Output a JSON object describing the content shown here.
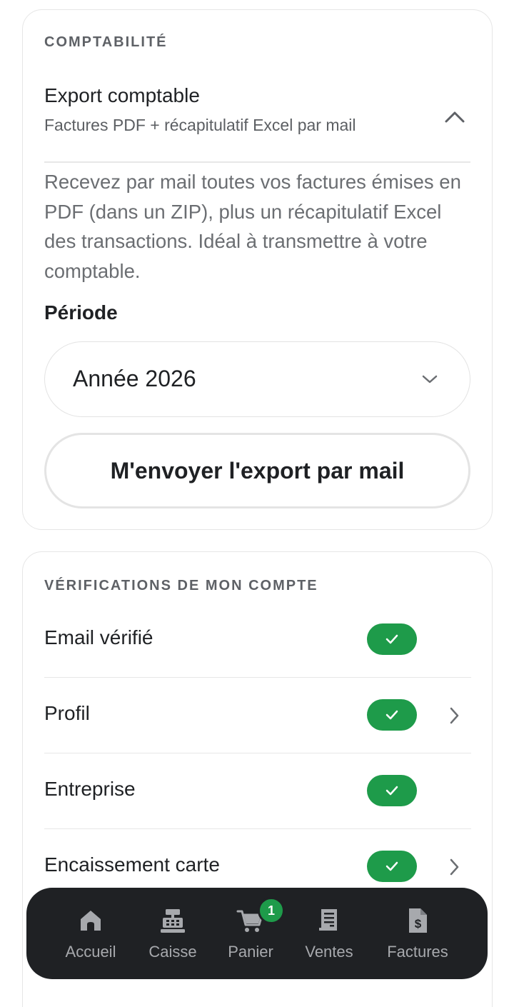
{
  "accounting": {
    "section_title": "COMPTABILITÉ",
    "export_title": "Export comptable",
    "export_subtitle": "Factures PDF + récapitulatif Excel par mail",
    "description": "Recevez par mail toutes vos factures émises en PDF (dans un ZIP), plus un récapitulatif Excel des transactions. Idéal à transmettre à votre comptable.",
    "period_label": "Période",
    "period_selected": "Année 2026",
    "send_button_label": "M'envoyer l'export par mail",
    "expanded": true
  },
  "verifications": {
    "section_title": "VÉRIFICATIONS DE MON COMPTE",
    "items": [
      {
        "label": "Email vérifié",
        "verified": true,
        "has_chevron": false
      },
      {
        "label": "Profil",
        "verified": true,
        "has_chevron": true
      },
      {
        "label": "Entreprise",
        "verified": true,
        "has_chevron": false
      },
      {
        "label": "Encaissement carte",
        "verified": true,
        "has_chevron": true
      }
    ]
  },
  "bottom_nav": {
    "items": [
      {
        "label": "Accueil",
        "icon": "home-icon"
      },
      {
        "label": "Caisse",
        "icon": "cash-register-icon"
      },
      {
        "label": "Panier",
        "icon": "cart-icon",
        "badge": "1"
      },
      {
        "label": "Ventes",
        "icon": "receipt-icon"
      },
      {
        "label": "Factures",
        "icon": "invoice-dollar-icon"
      }
    ]
  },
  "colors": {
    "success_green": "#1e9b4a",
    "nav_background": "#1f2124",
    "nav_text": "#a7a9ad",
    "card_border": "#e6e6e6"
  }
}
